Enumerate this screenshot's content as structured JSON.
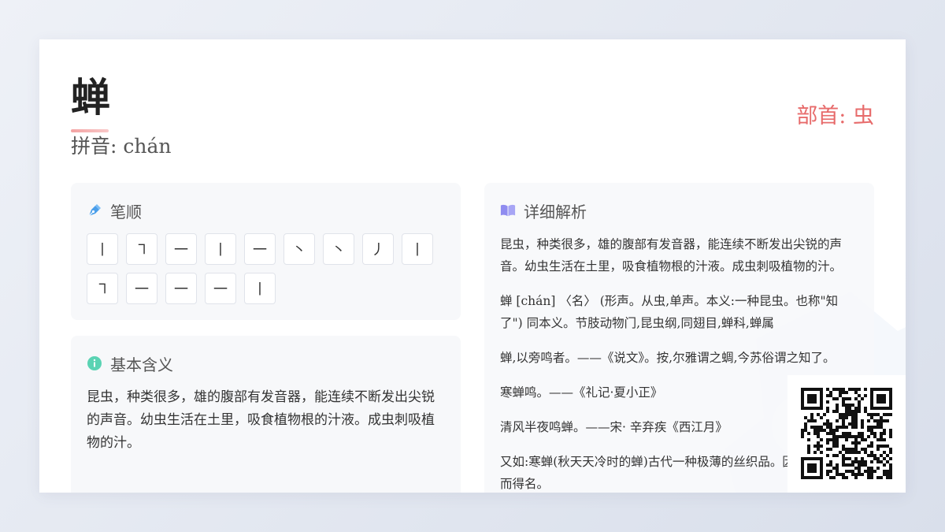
{
  "character": "蝉",
  "pinyin": "拼音: chán",
  "radical": "部首: 虫",
  "stroke_panel": {
    "title": "笔顺",
    "strokes": [
      "丨",
      "㇕",
      "一",
      "丨",
      "一",
      "丶",
      "丶",
      "丿",
      "丨",
      "㇕",
      "一",
      "一",
      "一",
      "丨"
    ]
  },
  "basic_panel": {
    "title": "基本含义",
    "text": "昆虫，种类很多，雄的腹部有发音器，能连续不断发出尖锐的声音。幼虫生活在土里，吸食植物根的汁液。成虫刺吸植物的汁。"
  },
  "detail_panel": {
    "title": "详细解析",
    "paragraphs": [
      "昆虫，种类很多，雄的腹部有发音器，能连续不断发出尖锐的声音。幼虫生活在土里，吸食植物根的汁液。成虫刺吸植物的汁。",
      "蝉 [chán] 〈名〉 (形声。从虫,单声。本义:一种昆虫。也称\"知了\") 同本义。节肢动物门,昆虫纲,同翅目,蝉科,蝉属",
      "蝉,以旁鸣者。——《说文》。按,尔雅谓之蜩,今苏俗谓之知了。",
      "寒蝉鸣。——《礼记·夏小正》",
      "清风半夜鸣蝉。——宋· 辛弃疾《西江月》",
      "又如:寒蝉(秋天天冷时的蝉)古代一种极薄的丝织品。因其薄如蝉翼而得名。"
    ]
  },
  "colors": {
    "accent_red": "#e76b6b",
    "pen_icon": "#4a9eea",
    "book_icon": "#8f8cf0",
    "info_icon": "#5ad3b3"
  },
  "icons": {
    "stroke": "pen-icon",
    "basic": "info-icon",
    "detail": "book-icon",
    "qr": "qr-code"
  }
}
